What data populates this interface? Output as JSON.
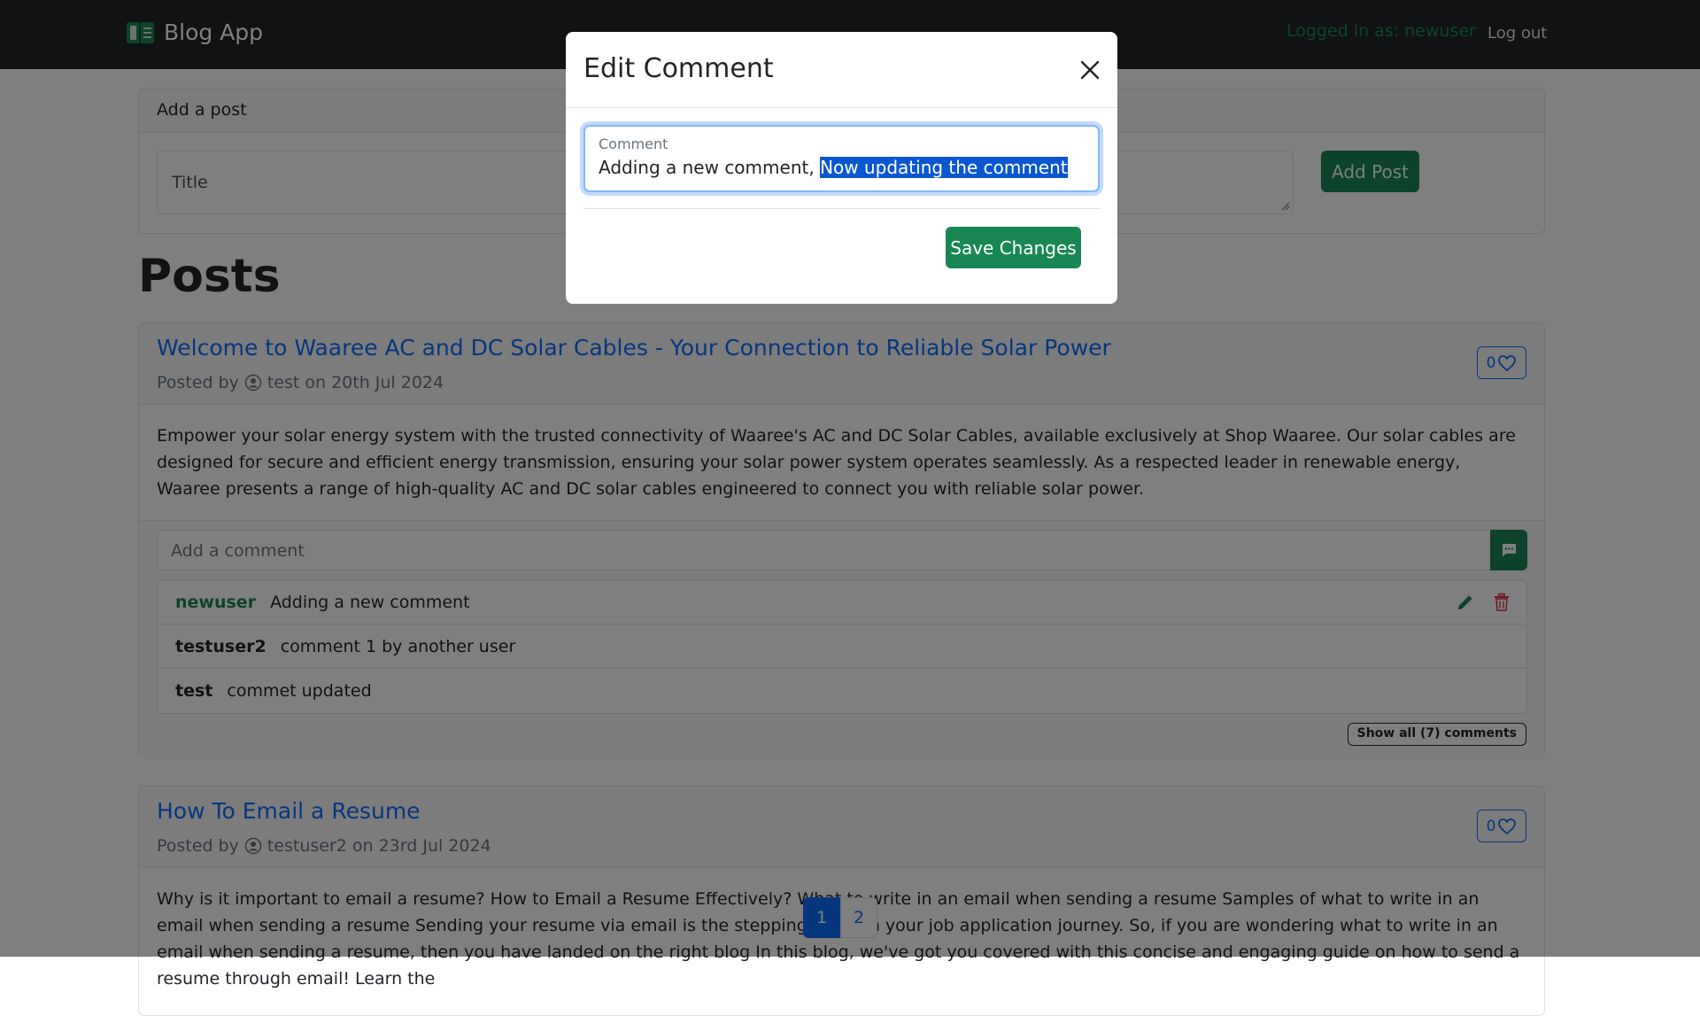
{
  "navbar": {
    "brand": "Blog App",
    "logged_in_text": "Logged in as: newuser",
    "logout": "Log out"
  },
  "add_post": {
    "header": "Add a post",
    "title_placeholder": "Title",
    "button": "Add Post"
  },
  "posts_heading": "Posts",
  "posts": [
    {
      "title": "Welcome to Waaree AC and DC Solar Cables - Your Connection to Reliable Solar Power",
      "posted_by_prefix": "Posted by",
      "author": "test",
      "date_text": "on 20th Jul 2024",
      "likes": "0",
      "body": "Empower your solar energy system with the trusted connectivity of Waaree's AC and DC Solar Cables, available exclusively at Shop Waaree. Our solar cables are designed for secure and efficient energy transmission, ensuring your solar power system operates seamlessly. As a respected leader in renewable energy, Waaree presents a range of high-quality AC and DC solar cables engineered to connect you with reliable solar power.",
      "comment_placeholder": "Add a comment",
      "comments": [
        {
          "user": "newuser",
          "text": "Adding a new comment"
        },
        {
          "user": "testuser2",
          "text": "comment 1 by another user"
        },
        {
          "user": "test",
          "text": "commet updated"
        }
      ],
      "show_all": "Show all (7) comments"
    },
    {
      "title": "How To Email a Resume",
      "posted_by_prefix": "Posted by",
      "author": "testuser2",
      "date_text": "on 23rd Jul 2024",
      "likes": "0",
      "body": "Why is it important to email a resume? How to Email a Resume Effectively? What to write in an email when sending a resume Samples of what to write in an email when sending a resume Sending your resume via email is the stepping stone in your job application journey. So, if you are wondering what to write in an email when sending a resume, then you have landed on the right blog In this blog, we've got you covered with this concise and engaging guide on how to send a resume through email! Learn the"
    }
  ],
  "pagination": {
    "pages": [
      "1",
      "2"
    ],
    "active": "1"
  },
  "modal": {
    "title": "Edit Comment",
    "field_label": "Comment",
    "value_plain": "Adding a new comment, ",
    "value_selected": "Now updating the comment",
    "save": "Save Changes"
  },
  "colors": {
    "navbar": "#212529",
    "primary": "#0d6efd",
    "success": "#198754",
    "danger": "#dc3545"
  }
}
